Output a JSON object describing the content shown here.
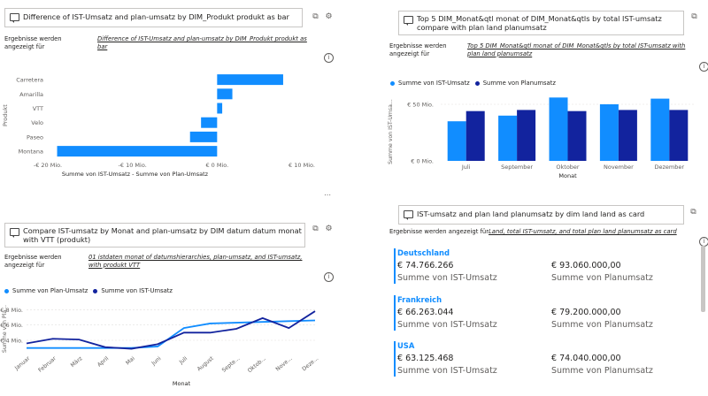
{
  "panel1": {
    "question": "Difference of IST-Umsatz and plan-umsatz by DIM_Produkt produkt as bar",
    "results_label": "Ergebnisse werden angezeigt für",
    "results_value": "Difference of IST-Umsatz and plan-umsatz by DIM_Produkt produkt as bar",
    "info": "i"
  },
  "panel2": {
    "question": "Top 5 DIM_Monat&qtl monat of DIM_Monat&qtls by total IST-umsatz compare with plan land planumsatz",
    "results_label": "Ergebnisse werden angezeigt für",
    "results_value": "Top 5 DIM_Monat&qtl monat of DIM_Monat&qtls by total IST-umsatz with plan land planumsatz",
    "info": "i"
  },
  "panel3": {
    "question": "Compare IST-umsatz by Monat and plan-umsatz by DIM datum datum monat with VTT (produkt)",
    "results_label": "Ergebnisse werden angezeigt für",
    "results_value": "01 istdaten monat of datumshierarchies, plan-umsatz, and IST-umsatz, with produkt VTT",
    "info": "i"
  },
  "panel4": {
    "question": "IST-umsatz and plan land planumsatz by dim land land as card",
    "results_label": "Ergebnisse werden angezeigt für",
    "results_value": "Land, total IST-umsatz, and total plan land planumsatz as card",
    "info": "i",
    "cards": [
      {
        "country": "Deutschland",
        "ist": "€ 74.766.266",
        "ist_label": "Summe von IST-Umsatz",
        "plan": "€ 93.060.000,00",
        "plan_label": "Summe von Planumsatz"
      },
      {
        "country": "Frankreich",
        "ist": "€ 66.263.044",
        "ist_label": "Summe von IST-Umsatz",
        "plan": "€ 79.200.000,00",
        "plan_label": "Summe von Planumsatz"
      },
      {
        "country": "USA",
        "ist": "€ 63.125.468",
        "ist_label": "Summe von IST-Umsatz",
        "plan": "€ 74.040.000,00",
        "plan_label": "Summe von Planumsatz"
      }
    ]
  },
  "colors": {
    "light": "#118dff",
    "dark": "#12239e"
  },
  "chart_data": [
    {
      "type": "bar",
      "orientation": "horizontal",
      "categories": [
        "Carretera",
        "Amarilla",
        "VTT",
        "Velo",
        "Paseo",
        "Montana"
      ],
      "values": [
        7.8,
        1.8,
        0.6,
        -1.9,
        -3.2,
        -18.9
      ],
      "xlabel": "Summe von IST-Umsatz - Summe von Plan-Umsatz",
      "ylabel": "Produkt",
      "xticks": [
        "-€ 20 Mio.",
        "-€ 10 Mio.",
        "€ 0 Mio.",
        "€ 10 Mio."
      ],
      "xlim": [
        -20,
        10
      ]
    },
    {
      "type": "bar",
      "categories": [
        "Juli",
        "September",
        "Oktober",
        "November",
        "Dezember"
      ],
      "series": [
        {
          "name": "Summe von IST-Umsatz",
          "values": [
            35,
            40,
            56,
            50,
            55
          ]
        },
        {
          "name": "Summe von Planumsatz",
          "values": [
            44,
            45,
            44,
            45,
            45
          ]
        }
      ],
      "xlabel": "Monat",
      "ylabel": "Summe von IST-Umsa...",
      "yticks": [
        "€ 0 Mio.",
        "€ 50 Mio."
      ],
      "ylim": [
        0,
        50
      ],
      "legend": "top-left"
    },
    {
      "type": "line",
      "categories": [
        "Januar",
        "Februar",
        "März",
        "April",
        "Mai",
        "Juni",
        "Juli",
        "August",
        "Septe...",
        "Oktob...",
        "Nove...",
        "Deze..."
      ],
      "series": [
        {
          "name": "Summe von Plan-Umsatz",
          "values": [
            3.0,
            3.0,
            3.0,
            3.0,
            3.0,
            3.2,
            5.6,
            6.2,
            6.3,
            6.4,
            6.5,
            6.6
          ]
        },
        {
          "name": "Summe von IST-Umsatz",
          "values": [
            3.6,
            4.2,
            4.1,
            3.1,
            2.9,
            3.5,
            5.0,
            5.0,
            5.5,
            6.9,
            5.6,
            7.8
          ]
        }
      ],
      "xlabel": "Monat",
      "ylabel": "Summe von Pla...",
      "yticks": [
        "€ 4 Mio.",
        "€ 6 Mio.",
        "€ 8 Mio."
      ],
      "ylim": [
        2.5,
        8.5
      ],
      "legend": "top-left"
    }
  ]
}
